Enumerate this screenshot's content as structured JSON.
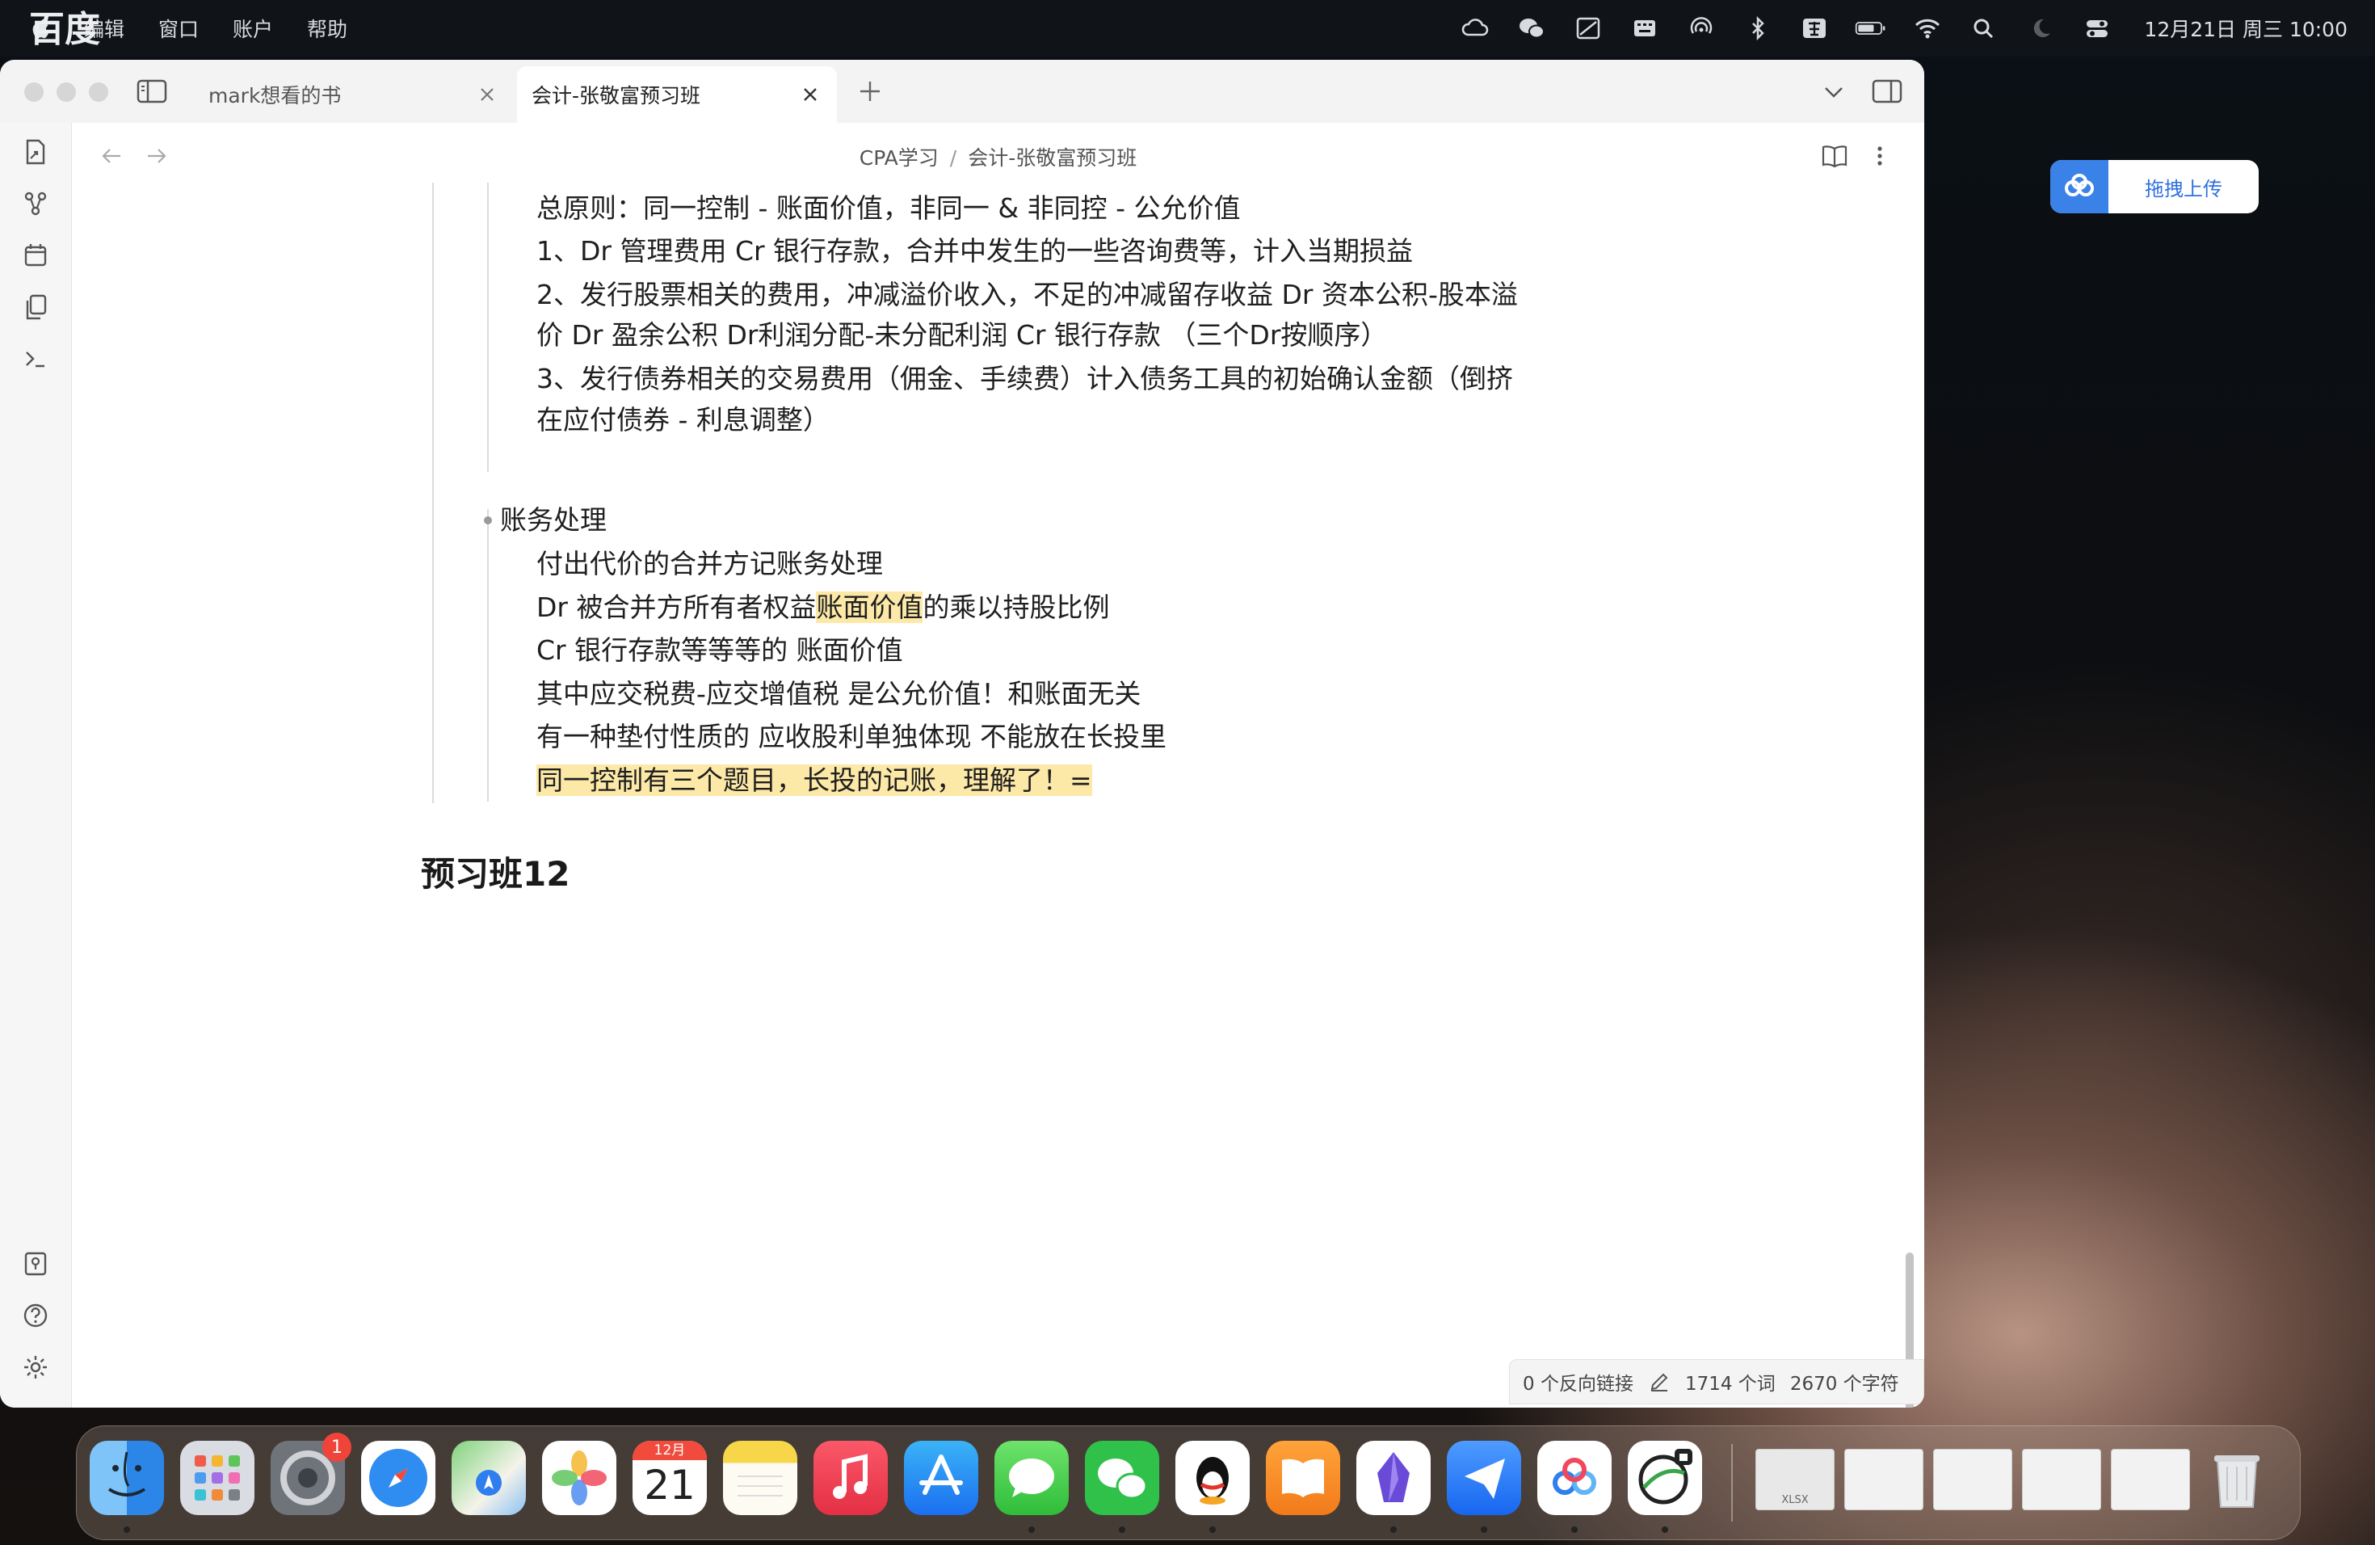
{
  "menubar": {
    "app_name": "百度网盘",
    "menus": [
      "编辑",
      "窗口",
      "账户",
      "帮助"
    ],
    "clock": "12月21日 周三 10:00"
  },
  "window": {
    "tabs": [
      {
        "label": "mark想看的书",
        "active": false
      },
      {
        "label": "会计-张敬富预习班",
        "active": true
      }
    ],
    "breadcrumb": {
      "folder": "CPA学习",
      "separator": "/",
      "file": "会计-张敬富预习班"
    }
  },
  "note": {
    "principle_lines": [
      "总原则：同一控制 - 账面价值，非同一 & 非同控 - 公允价值",
      "1、Dr 管理费用 Cr 银行存款，合并中发生的一些咨询费等，计入当期损益",
      "2、发行股票相关的费用，冲减溢价收入，不足的冲减留存收益 Dr 资本公积-股本溢",
      "价 Dr 盈余公积 Dr利润分配-未分配利润 Cr 银行存款 （三个Dr按顺序）",
      "3、发行债券相关的交易费用（佣金、手续费）计入债务工具的初始确认金额（倒挤",
      "在应付债券 - 利息调整）"
    ],
    "bullet_heading": "账务处理",
    "accounting_lines": [
      "付出代价的合并方记账务处理",
      "Dr 被合并方所有者权益",
      "账面价值",
      "的乘以持股比例",
      "Cr 银行存款等等等的 账面价值",
      "其中应交税费-应交增值税 是公允价值！和账面无关",
      "有一种垫付性质的 应收股利单独体现 不能放在长投里",
      "同一控制有三个题目，长投的记账，理解了！="
    ],
    "section_heading": "预习班12"
  },
  "statusbar": {
    "backlinks": "0 个反向链接",
    "words": "1714 个词",
    "chars": "2670 个字符"
  },
  "baidu_upload": {
    "label": "拖拽上传"
  },
  "dock": {
    "calendar_month": "12月",
    "calendar_day": "21",
    "settings_badge": "1",
    "thumb_label": "XLSX"
  },
  "colors": {
    "highlight": "#fde9a7",
    "accent_blue": "#3b82e8"
  }
}
